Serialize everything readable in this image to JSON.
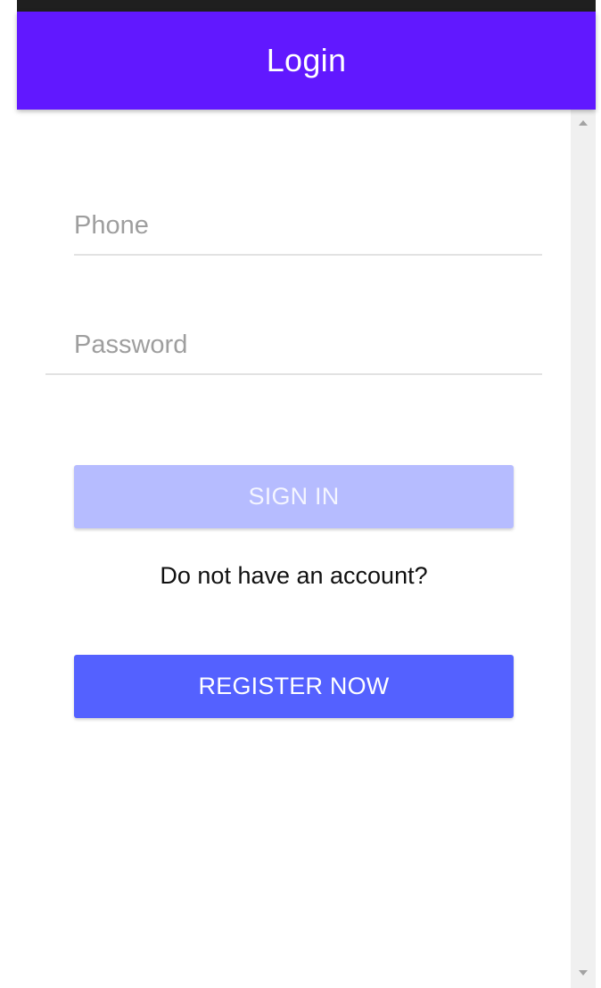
{
  "header": {
    "title": "Login"
  },
  "form": {
    "phone_placeholder": "Phone",
    "password_placeholder": "Password",
    "sign_in_label": "SIGN IN",
    "prompt": "Do not have an account?",
    "register_label": "REGISTER NOW"
  },
  "colors": {
    "app_bar": "#6118ff",
    "sign_in_disabled": "#b6bcff",
    "register_button": "#5461ff"
  },
  "icons": {
    "scroll_up": "scroll-up-arrow-icon",
    "scroll_down": "scroll-down-arrow-icon"
  }
}
